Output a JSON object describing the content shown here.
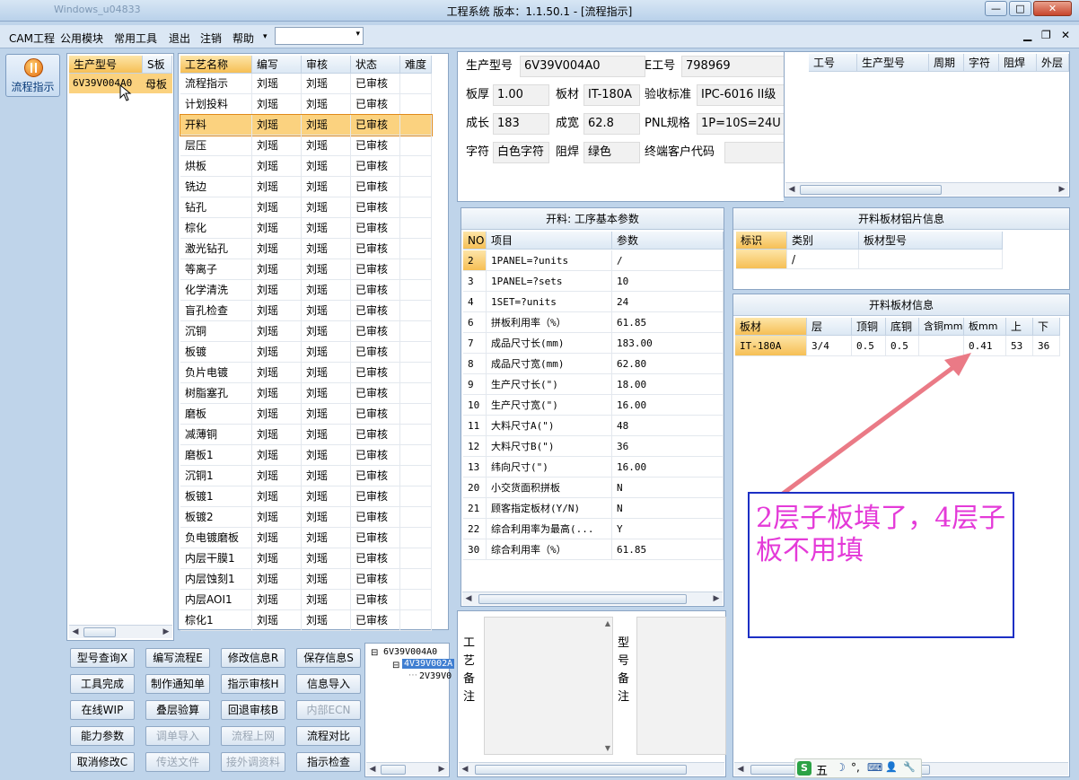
{
  "window": {
    "title": "工程系统  版本：1.1.50.1 - [流程指示]",
    "faint_title": "Windows_u04833",
    "controls": [
      "—",
      "□",
      "✕"
    ],
    "mdi_controls": [
      "▁",
      "❐",
      "✕"
    ]
  },
  "menu": {
    "items": [
      "CAM工程",
      "公用模块",
      "常用工具",
      "退出",
      "注销",
      "帮助"
    ],
    "combo_arrow": "▾"
  },
  "left_nav": {
    "label": "流程指示",
    "icon": "process-icon"
  },
  "model_list": {
    "headers": [
      "生产型号",
      "S板"
    ],
    "rows": [
      [
        "6V39V004A0",
        "母板"
      ]
    ]
  },
  "process_table": {
    "headers": [
      "工艺名称",
      "编写",
      "审核",
      "状态",
      "难度"
    ],
    "rows": [
      [
        "流程指示",
        "刘瑶",
        "刘瑶",
        "已审核",
        ""
      ],
      [
        "计划投料",
        "刘瑶",
        "刘瑶",
        "已审核",
        ""
      ],
      [
        "开料",
        "刘瑶",
        "刘瑶",
        "已审核",
        ""
      ],
      [
        "层压",
        "刘瑶",
        "刘瑶",
        "已审核",
        ""
      ],
      [
        "烘板",
        "刘瑶",
        "刘瑶",
        "已审核",
        ""
      ],
      [
        "铣边",
        "刘瑶",
        "刘瑶",
        "已审核",
        ""
      ],
      [
        "钻孔",
        "刘瑶",
        "刘瑶",
        "已审核",
        ""
      ],
      [
        "棕化",
        "刘瑶",
        "刘瑶",
        "已审核",
        ""
      ],
      [
        "激光钻孔",
        "刘瑶",
        "刘瑶",
        "已审核",
        ""
      ],
      [
        "等离子",
        "刘瑶",
        "刘瑶",
        "已审核",
        ""
      ],
      [
        "化学清洗",
        "刘瑶",
        "刘瑶",
        "已审核",
        ""
      ],
      [
        "盲孔检查",
        "刘瑶",
        "刘瑶",
        "已审核",
        ""
      ],
      [
        "沉铜",
        "刘瑶",
        "刘瑶",
        "已审核",
        ""
      ],
      [
        "板镀",
        "刘瑶",
        "刘瑶",
        "已审核",
        ""
      ],
      [
        "负片电镀",
        "刘瑶",
        "刘瑶",
        "已审核",
        ""
      ],
      [
        "树脂塞孔",
        "刘瑶",
        "刘瑶",
        "已审核",
        ""
      ],
      [
        "磨板",
        "刘瑶",
        "刘瑶",
        "已审核",
        ""
      ],
      [
        "减薄铜",
        "刘瑶",
        "刘瑶",
        "已审核",
        ""
      ],
      [
        "磨板1",
        "刘瑶",
        "刘瑶",
        "已审核",
        ""
      ],
      [
        "沉铜1",
        "刘瑶",
        "刘瑶",
        "已审核",
        ""
      ],
      [
        "板镀1",
        "刘瑶",
        "刘瑶",
        "已审核",
        ""
      ],
      [
        "板镀2",
        "刘瑶",
        "刘瑶",
        "已审核",
        ""
      ],
      [
        "负电镀磨板",
        "刘瑶",
        "刘瑶",
        "已审核",
        ""
      ],
      [
        "内层干膜1",
        "刘瑶",
        "刘瑶",
        "已审核",
        ""
      ],
      [
        "内层蚀刻1",
        "刘瑶",
        "刘瑶",
        "已审核",
        ""
      ],
      [
        "内层AOI1",
        "刘瑶",
        "刘瑶",
        "已审核",
        ""
      ],
      [
        "棕化1",
        "刘瑶",
        "刘瑶",
        "已审核",
        ""
      ]
    ],
    "selected_index": 2
  },
  "buttons": [
    [
      {
        "label": "型号查询X",
        "enabled": true
      },
      {
        "label": "编写流程E",
        "enabled": true
      },
      {
        "label": "修改信息R",
        "enabled": true
      },
      {
        "label": "保存信息S",
        "enabled": true
      }
    ],
    [
      {
        "label": "工具完成",
        "enabled": true
      },
      {
        "label": "制作通知单",
        "enabled": true
      },
      {
        "label": "指示审核H",
        "enabled": true
      },
      {
        "label": "信息导入",
        "enabled": true
      }
    ],
    [
      {
        "label": "在线WIP",
        "enabled": true
      },
      {
        "label": "叠层验算",
        "enabled": true
      },
      {
        "label": "回退审核B",
        "enabled": true
      },
      {
        "label": "内部ECN",
        "enabled": false
      }
    ],
    [
      {
        "label": "能力参数",
        "enabled": true
      },
      {
        "label": "调单导入",
        "enabled": false
      },
      {
        "label": "流程上网",
        "enabled": false
      },
      {
        "label": "流程对比",
        "enabled": true
      }
    ],
    [
      {
        "label": "取消修改C",
        "enabled": true
      },
      {
        "label": "传送文件",
        "enabled": false
      },
      {
        "label": "接外调资料",
        "enabled": false
      },
      {
        "label": "指示检查",
        "enabled": true
      }
    ]
  ],
  "tree": {
    "nodes": [
      {
        "label": "6V39V004A0",
        "toggle": "⊟"
      },
      {
        "label": "4V39V002A",
        "toggle": "⊟"
      },
      {
        "label": "2V39V0",
        "toggle": ""
      }
    ]
  },
  "info": {
    "production_model": {
      "label": "生产型号",
      "value": "6V39V004A0"
    },
    "e_number": {
      "label": "E工号",
      "value": "798969"
    },
    "board_thickness": {
      "label": "板厚",
      "value": "1.00"
    },
    "board_material": {
      "label": "板材",
      "value": "IT-180A"
    },
    "acceptance_standard": {
      "label": "验收标准",
      "value": "IPC-6016 II级"
    },
    "length": {
      "label": "成长",
      "value": "183"
    },
    "width": {
      "label": "成宽",
      "value": "62.8"
    },
    "pnl_spec": {
      "label": "PNL规格",
      "value": "1P=10S=24U"
    },
    "character": {
      "label": "字符",
      "value": "白色字符"
    },
    "solder_mask": {
      "label": "阻焊",
      "value": "绿色"
    },
    "end_customer_code": {
      "label": "终端客户代码",
      "value": ""
    }
  },
  "right_top_table": {
    "headers": [
      "工号",
      "生产型号",
      "周期",
      "字符",
      "阻焊",
      "外层"
    ]
  },
  "params": {
    "title": "开料: 工序基本参数",
    "headers": [
      "NO",
      "项目",
      "参数"
    ],
    "rows": [
      [
        "2",
        "1PANEL=?units",
        "/"
      ],
      [
        "3",
        "1PANEL=?sets",
        "10"
      ],
      [
        "4",
        "1SET=?units",
        "24"
      ],
      [
        "6",
        "拼板利用率（%）",
        "61.85"
      ],
      [
        "7",
        "成品尺寸长(mm)",
        "183.00"
      ],
      [
        "8",
        "成品尺寸宽(mm)",
        "62.80"
      ],
      [
        "9",
        "生产尺寸长(\")",
        "18.00"
      ],
      [
        "10",
        "生产尺寸宽(\")",
        "16.00"
      ],
      [
        "11",
        "大料尺寸A(\")",
        "48"
      ],
      [
        "12",
        "大料尺寸B(\")",
        "36"
      ],
      [
        "13",
        "纬向尺寸(\")",
        "16.00"
      ],
      [
        "20",
        "小交货面积拼板",
        "N"
      ],
      [
        "21",
        "顾客指定板材(Y/N)",
        "N"
      ],
      [
        "22",
        "综合利用率为最高(...",
        "Y"
      ],
      [
        "30",
        "综合利用率（%）",
        "61.85"
      ]
    ]
  },
  "sheet_info": {
    "title": "开料板材铝片信息",
    "headers": [
      "标识",
      "类别",
      "板材型号"
    ],
    "rows": [
      [
        "",
        "/",
        ""
      ]
    ]
  },
  "board_info": {
    "title": "开料板材信息",
    "headers": [
      "板材",
      "层",
      "顶铜",
      "底铜",
      "含铜mm",
      "板mm",
      "上",
      "下"
    ],
    "rows": [
      [
        "IT-180A",
        "3/4",
        "0.5",
        "0.5",
        "",
        "0.41",
        "53",
        "36"
      ]
    ]
  },
  "annotation": {
    "text": "2层子板填了，4层子板不用填"
  },
  "remarks": {
    "process_label": "工艺备注",
    "model_label": "型号备注"
  },
  "ime_bar": {
    "items": [
      "S",
      "五",
      "☽",
      "°,",
      "⌨",
      "👤",
      "🔧"
    ]
  },
  "colors": {
    "accent_orange": "#f6bf55",
    "annotation_text": "#e43ad8",
    "annotation_border": "#1c2fc4",
    "arrow": "#ea7a86"
  }
}
